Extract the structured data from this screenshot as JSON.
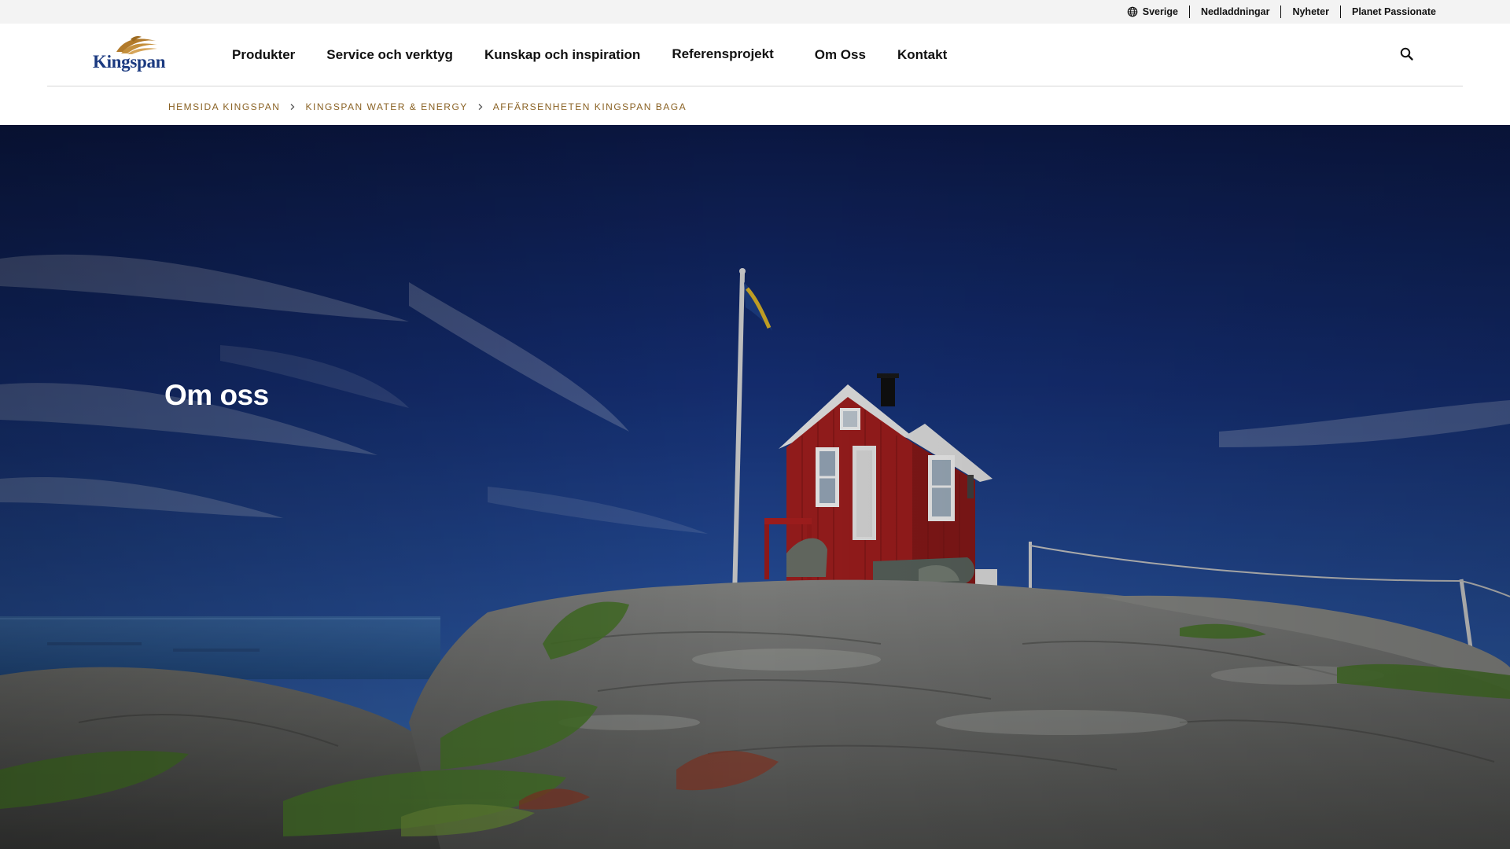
{
  "utility": {
    "locale": "Sverige",
    "links": [
      "Nedladdningar",
      "Nyheter",
      "Planet Passionate"
    ]
  },
  "header": {
    "logo_text": "Kingspan",
    "nav": [
      "Produkter",
      "Service och verktyg",
      "Kunskap och inspiration",
      "Referensprojekt",
      "Om Oss",
      "Kontakt"
    ]
  },
  "breadcrumb": [
    "HEMSIDA KINGSPAN",
    "KINGSPAN WATER & ENERGY",
    "AFFÄRSENHETEN KINGSPAN BAGA"
  ],
  "hero": {
    "title": "Om oss",
    "image": "Red wooden cottage with flagpole on granite rocks by the sea"
  },
  "colors": {
    "brand_blue": "#1b3a80",
    "brand_gold": "#b27a2a",
    "breadcrumb": "#8a6224",
    "utility_bg": "#f3f3f3"
  },
  "icons": {
    "locale": "globe-icon",
    "search": "search-icon",
    "separator": "chevron-right-icon"
  }
}
